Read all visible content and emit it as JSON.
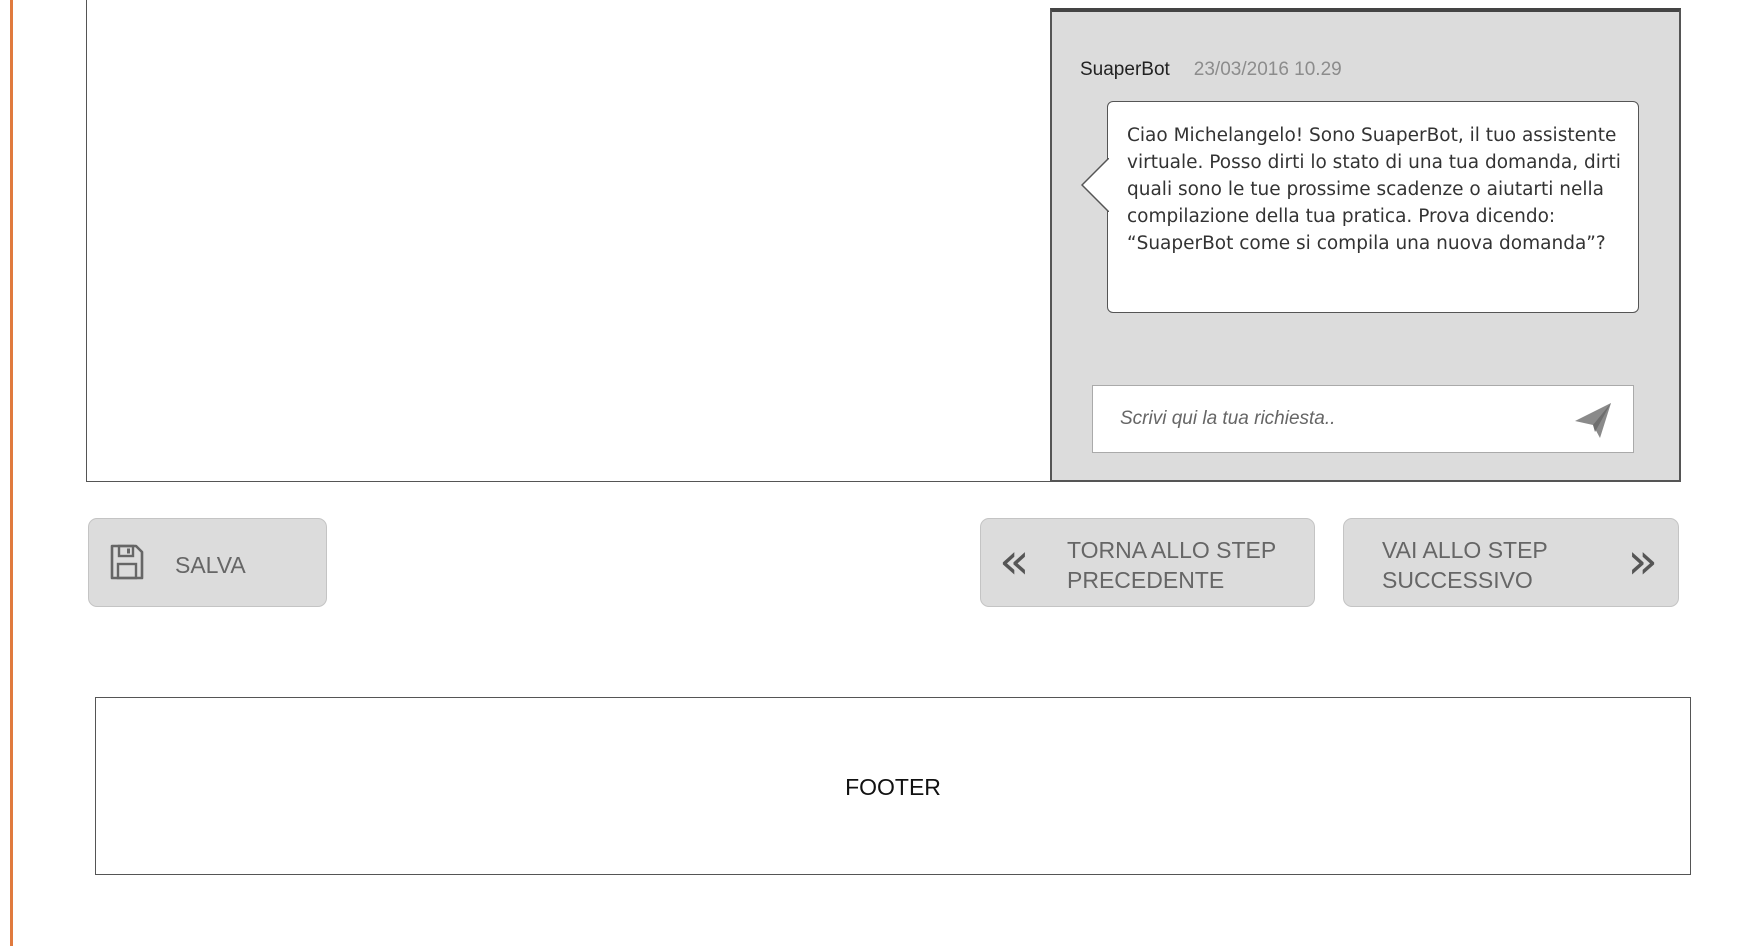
{
  "chat": {
    "sender": "SuaperBot",
    "timestamp": "23/03/2016 10.29",
    "message": "Ciao Michelangelo! Sono SuaperBot, il tuo assistente virtuale. Posso dirti lo stato di una tua domanda, dirti quali sono le tue prossime scadenze o aiutarti nella compilazione della tua pratica. Prova dicendo: “SuaperBot come si compila una nuova domanda”?",
    "input_placeholder": "Scrivi qui la tua richiesta..",
    "input_value": "",
    "send_icon": "paper-plane-icon"
  },
  "actions": {
    "save": {
      "icon": "floppy-disk-icon",
      "label": "SALVA"
    },
    "prev": {
      "icon": "double-chevron-left-icon",
      "line1": "TORNA ALLO STEP",
      "line2": "PRECEDENTE"
    },
    "next": {
      "icon": "double-chevron-right-icon",
      "line1": "VAI ALLO STEP",
      "line2": "SUCCESSIVO"
    }
  },
  "footer": {
    "label": "FOOTER"
  },
  "colors": {
    "accent": "#e07a3e",
    "panel_bg": "#dcdcdc",
    "button_bg": "#dcdcdc",
    "text_muted": "#8c8c8c"
  }
}
